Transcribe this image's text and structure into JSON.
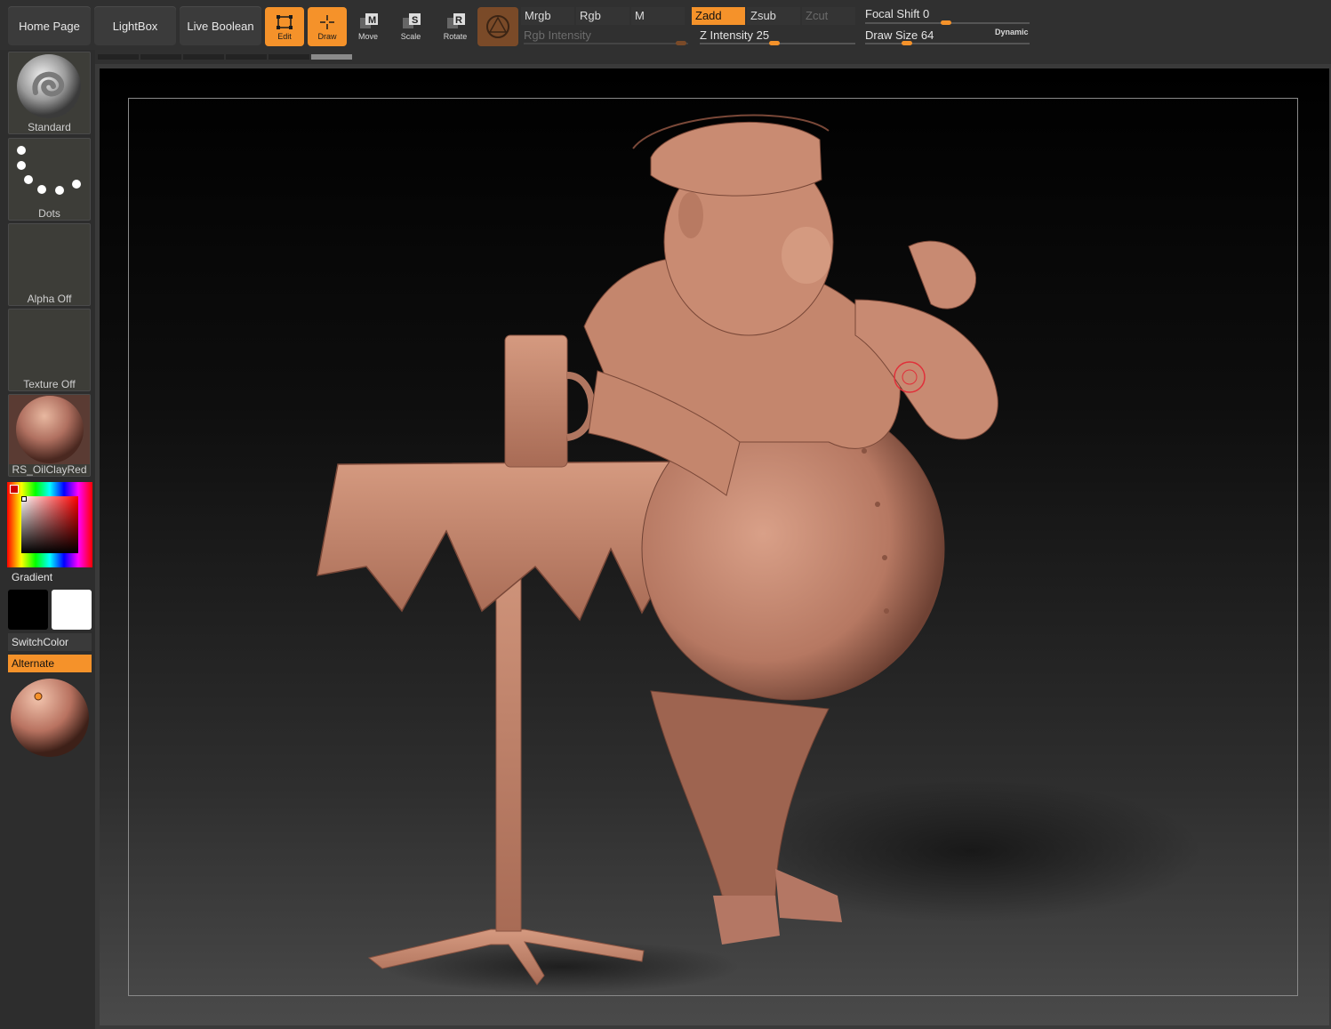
{
  "nav": {
    "home": "Home Page",
    "lightbox": "LightBox",
    "live_boolean": "Live Boolean"
  },
  "tools": {
    "edit": "Edit",
    "draw": "Draw",
    "move": "Move",
    "scale": "Scale",
    "rotate": "Rotate"
  },
  "modes": {
    "mrgb": "Mrgb",
    "rgb": "Rgb",
    "m": "M",
    "zadd": "Zadd",
    "zsub": "Zsub",
    "zcut": "Zcut",
    "rgb_intensity": "Rgb Intensity",
    "z_intensity_label": "Z Intensity",
    "z_intensity_value": "25"
  },
  "sliders": {
    "focal_shift_label": "Focal Shift",
    "focal_shift_value": "0",
    "draw_size_label": "Draw Size",
    "draw_size_value": "64",
    "dynamic": "Dynamic"
  },
  "left_panel": {
    "brush": "Standard",
    "stroke": "Dots",
    "alpha": "Alpha Off",
    "texture": "Texture Off",
    "material": "RS_OilClayRed",
    "gradient": "Gradient",
    "switch_color": "SwitchColor",
    "alternate": "Alternate"
  },
  "colors": {
    "accent": "#f5922a",
    "clay": "#c98b72",
    "panel": "#2d2d2d"
  }
}
